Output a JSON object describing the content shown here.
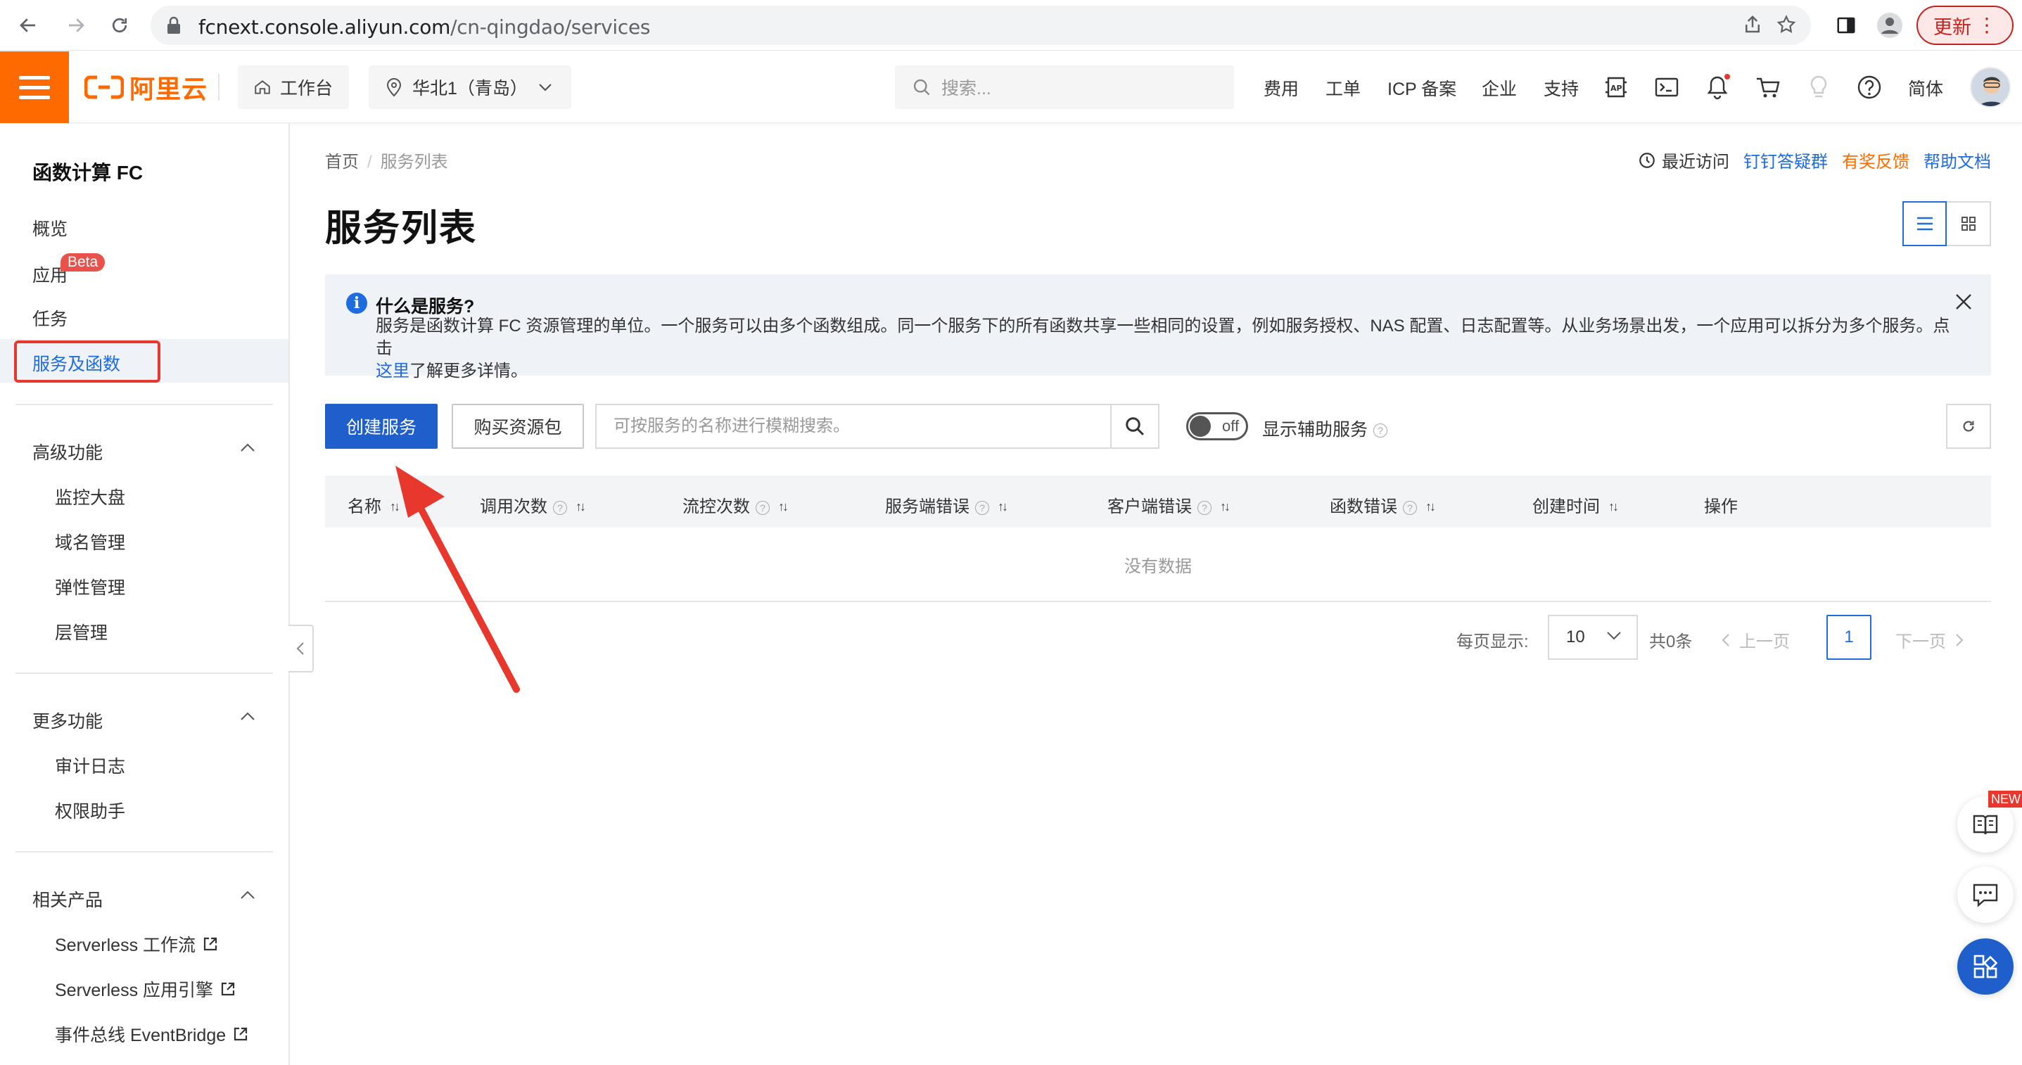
{
  "browser": {
    "url_host": "fcnext.console.aliyun.com",
    "url_path": "/cn-qingdao/services",
    "update_label": "更新"
  },
  "header": {
    "brand": "阿里云",
    "workbench": "工作台",
    "region": "华北1（青岛）",
    "search_placeholder": "搜索...",
    "links": [
      "费用",
      "工单",
      "ICP 备案",
      "企业",
      "支持"
    ],
    "lang": "简体"
  },
  "sidebar": {
    "title": "函数计算 FC",
    "items": [
      "概览",
      "应用",
      "任务",
      "服务及函数"
    ],
    "beta_badge": "Beta",
    "groups": [
      {
        "label": "高级功能",
        "items": [
          "监控大盘",
          "域名管理",
          "弹性管理",
          "层管理"
        ]
      },
      {
        "label": "更多功能",
        "items": [
          "审计日志",
          "权限助手"
        ]
      },
      {
        "label": "相关产品",
        "items": [
          "Serverless 工作流",
          "Serverless 应用引擎",
          "事件总线 EventBridge"
        ]
      }
    ]
  },
  "breadcrumb": {
    "home": "首页",
    "current": "服务列表"
  },
  "top_links": {
    "recent": "最近访问",
    "dingtalk": "钉钉答疑群",
    "feedback": "有奖反馈",
    "docs": "帮助文档"
  },
  "page_title": "服务列表",
  "info": {
    "title": "什么是服务?",
    "body": "服务是函数计算 FC 资源管理的单位。一个服务可以由多个函数组成。同一个服务下的所有函数共享一些相同的设置，例如服务授权、NAS 配置、日志配置等。从业务场景出发，一个应用可以拆分为多个服务。点击",
    "link": "这里",
    "tail": "了解更多详情。"
  },
  "toolbar": {
    "create_label": "创建服务",
    "buy_label": "购买资源包",
    "search_placeholder": "可按服务的名称进行模糊搜索。",
    "toggle_text": "off",
    "aux_label": "显示辅助服务"
  },
  "table": {
    "columns": [
      "名称",
      "调用次数",
      "流控次数",
      "服务端错误",
      "客户端错误",
      "函数错误",
      "创建时间",
      "操作"
    ],
    "empty_text": "没有数据"
  },
  "pagination": {
    "page_size_label": "每页显示:",
    "page_size": "10",
    "total": "共0条",
    "prev": "上一页",
    "current": "1",
    "next": "下一页"
  },
  "floating": {
    "new_badge": "NEW"
  },
  "colors": {
    "brand": "#ff6a00",
    "primary": "#1f5fcb",
    "link": "#1f6be0",
    "annotation": "#e8372c",
    "feedback": "#ff6a00"
  }
}
